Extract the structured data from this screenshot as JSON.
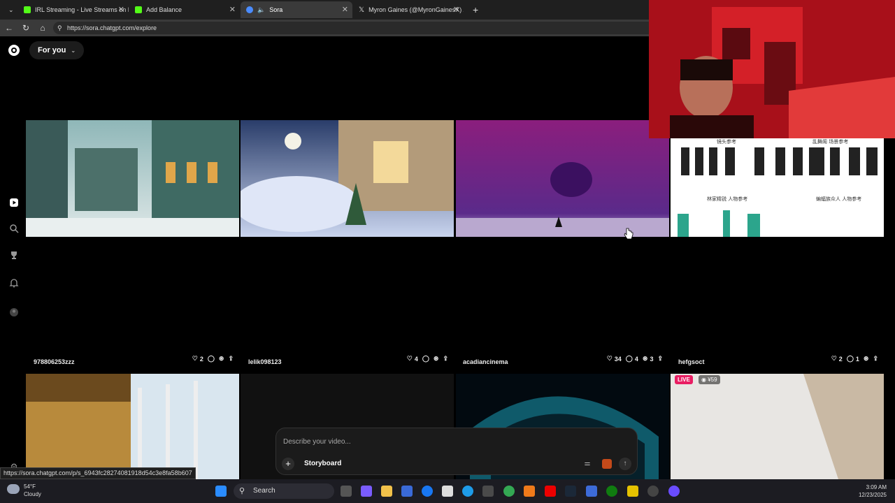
{
  "browser": {
    "tabs": [
      {
        "label": "IRL Streaming - Live Streams on K",
        "active": false
      },
      {
        "label": "Add Balance",
        "active": false
      },
      {
        "label": "Sora",
        "active": true
      },
      {
        "label": "Myron Gaines (@MyronGainesX) /",
        "active": false
      }
    ],
    "new_tab": "+",
    "url": "https://sora.chatgpt.com/explore"
  },
  "app": {
    "feed_selector": "For you"
  },
  "feed": {
    "row2_meta": [
      {
        "username": "978806253zzz",
        "likes": "2",
        "comments": "",
        "remixes": ""
      },
      {
        "username": "lelik098123",
        "likes": "4",
        "comments": "",
        "remixes": ""
      },
      {
        "username": "acadiancinema",
        "likes": "34",
        "comments": "4",
        "remixes": "3"
      },
      {
        "username": "hefgsoct",
        "likes": "2",
        "comments": "1",
        "remixes": ""
      }
    ],
    "live_badge": "LIVE",
    "viewer_count": "¥59",
    "tile4_labels": [
      "镜头参考",
      "乱舞阁 场景参考",
      "林家精锐 人物参考",
      "蝙蝠族众人 人物参考"
    ]
  },
  "composer": {
    "placeholder": "Describe your video...",
    "storyboard_label": "Storyboard"
  },
  "status_url": "https://sora.chatgpt.com/p/s_6943fc28274081918d54c3e8fa58b607",
  "taskbar": {
    "weather_temp": "54°F",
    "weather_desc": "Cloudy",
    "search_label": "Search",
    "time": "3:09 AM",
    "date": "12/23/2025"
  },
  "colors": {
    "live_badge": "#e91e63",
    "webcam_red": "#c0141a",
    "tab_bar": "#1f1f1f",
    "kick_green": "#53fc18"
  }
}
